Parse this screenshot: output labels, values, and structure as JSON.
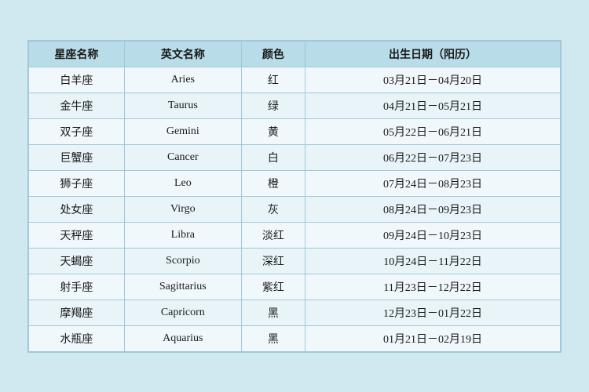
{
  "table": {
    "headers": {
      "name": "星座名称",
      "english": "英文名称",
      "color": "颜色",
      "date": "出生日期（阳历）"
    },
    "rows": [
      {
        "name": "白羊座",
        "english": "Aries",
        "color": "红",
        "date": "03月21日－04月20日"
      },
      {
        "name": "金牛座",
        "english": "Taurus",
        "color": "绿",
        "date": "04月21日－05月21日"
      },
      {
        "name": "双子座",
        "english": "Gemini",
        "color": "黄",
        "date": "05月22日－06月21日"
      },
      {
        "name": "巨蟹座",
        "english": "Cancer",
        "color": "白",
        "date": "06月22日－07月23日"
      },
      {
        "name": "狮子座",
        "english": "Leo",
        "color": "橙",
        "date": "07月24日－08月23日"
      },
      {
        "name": "处女座",
        "english": "Virgo",
        "color": "灰",
        "date": "08月24日－09月23日"
      },
      {
        "name": "天秤座",
        "english": "Libra",
        "color": "淡红",
        "date": "09月24日－10月23日"
      },
      {
        "name": "天蝎座",
        "english": "Scorpio",
        "color": "深红",
        "date": "10月24日－11月22日"
      },
      {
        "name": "射手座",
        "english": "Sagittarius",
        "color": "紫红",
        "date": "11月23日－12月22日"
      },
      {
        "name": "摩羯座",
        "english": "Capricorn",
        "color": "黑",
        "date": "12月23日－01月22日"
      },
      {
        "name": "水瓶座",
        "english": "Aquarius",
        "color": "黑",
        "date": "01月21日－02月19日"
      }
    ]
  }
}
